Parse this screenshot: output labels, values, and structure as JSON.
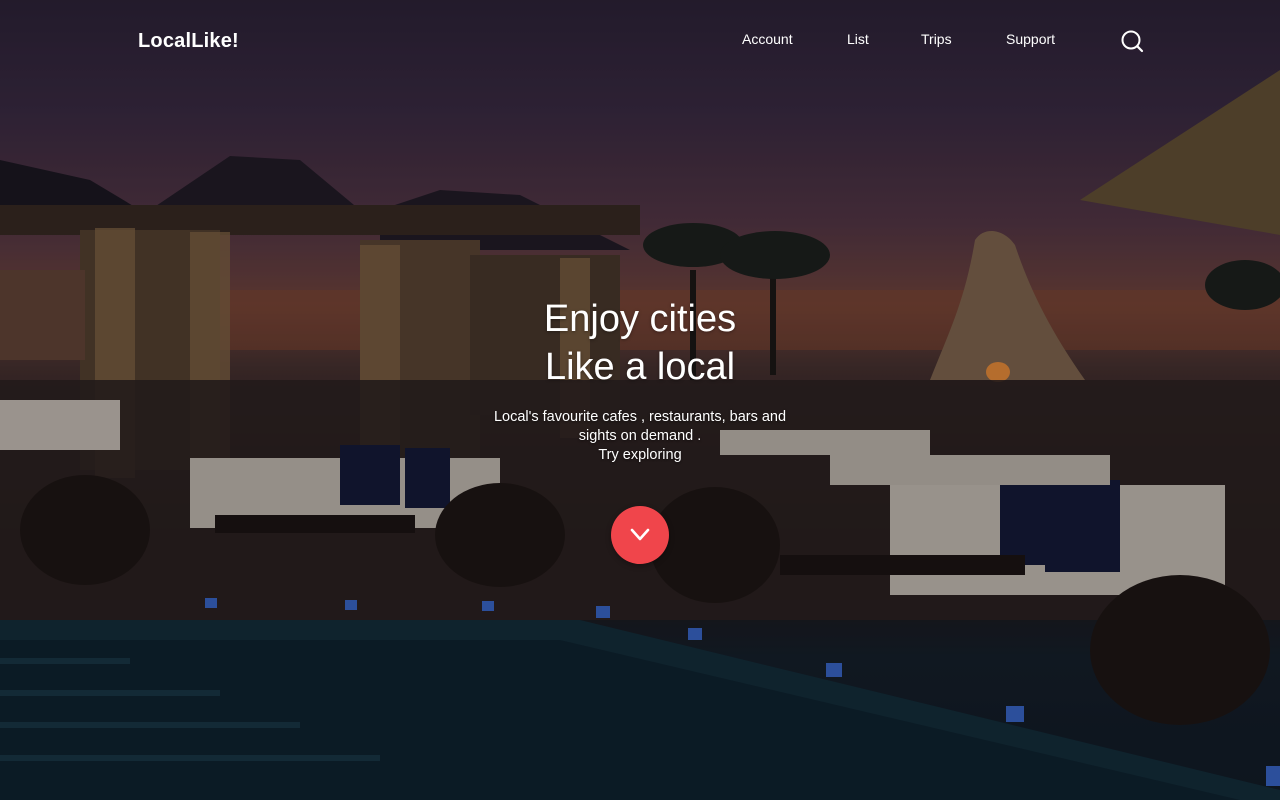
{
  "brand": {
    "name": "LocalLike!"
  },
  "nav": {
    "items": [
      {
        "label": "Account"
      },
      {
        "label": "List"
      },
      {
        "label": "Trips"
      },
      {
        "label": "Support"
      }
    ],
    "search_icon": "search-icon"
  },
  "hero": {
    "headline": "Enjoy cities",
    "subheadline": "Like a local",
    "tagline_line1": "Local's favourite cafes , restaurants, bars and",
    "tagline_line2": "sights on demand .",
    "tagline_line3": "Try exploring",
    "scroll_icon": "chevron-down-icon",
    "scroll_button_color": "#f0454b"
  },
  "colors": {
    "accent": "#f0454b",
    "text": "#ffffff"
  }
}
